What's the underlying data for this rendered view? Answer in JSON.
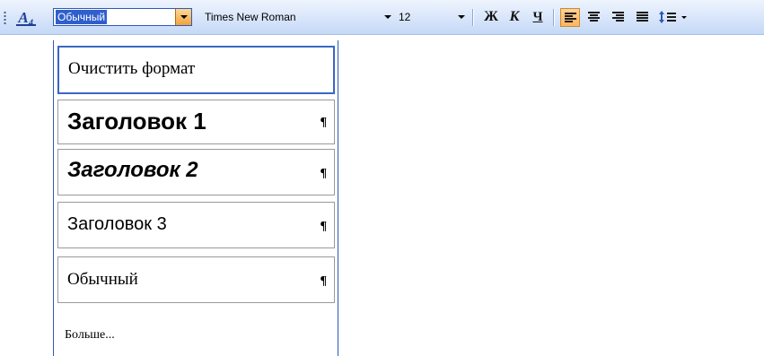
{
  "toolbar": {
    "styles_icon": "A₄",
    "style_value": "Обычный",
    "font_value": "Times New Roman",
    "size_value": "12",
    "bold_label": "Ж",
    "italic_label": "К",
    "underline_label": "Ч",
    "active_alignment": "left",
    "accent_color": "#ffb55d"
  },
  "style_menu": {
    "items": [
      {
        "label": "Очистить формат",
        "mark": ""
      },
      {
        "label": "Заголовок 1",
        "mark": "¶"
      },
      {
        "label": "Заголовок 2",
        "mark": "¶"
      },
      {
        "label": "Заголовок 3",
        "mark": "¶"
      },
      {
        "label": "Обычный",
        "mark": "¶"
      }
    ],
    "more_label": "Больше..."
  }
}
